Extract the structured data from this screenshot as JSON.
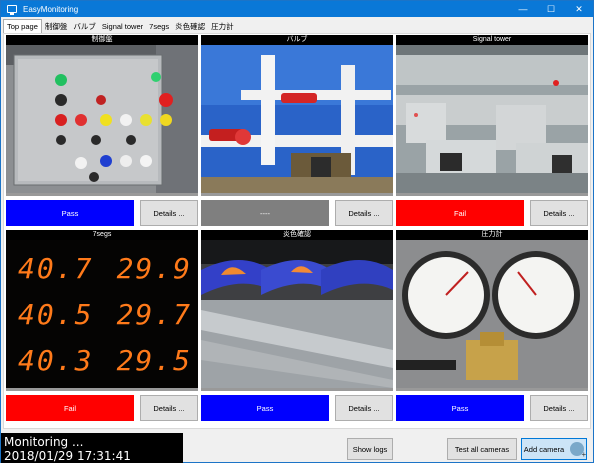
{
  "window": {
    "title": "EasyMonitoring"
  },
  "title_controls": {
    "minimize": "—",
    "maximize": "☐",
    "close": "✕"
  },
  "tabs": [
    "Top page",
    "制御盤",
    "バルブ",
    "Signal tower",
    "7segs",
    "炎色確認",
    "圧力計"
  ],
  "cameras": [
    {
      "title": "制御盤",
      "status": "Pass",
      "status_type": "pass",
      "details": "Details ..."
    },
    {
      "title": "バルブ",
      "status": "----",
      "status_type": "none",
      "details": "Details ..."
    },
    {
      "title": "Signal tower",
      "status": "Fail",
      "status_type": "fail",
      "details": "Details ..."
    },
    {
      "title": "7segs",
      "status": "Fail",
      "status_type": "fail",
      "details": "Details ..."
    },
    {
      "title": "炎色確認",
      "status": "Pass",
      "status_type": "pass",
      "details": "Details ..."
    },
    {
      "title": "圧力計",
      "status": "Pass",
      "status_type": "pass",
      "details": "Details ..."
    }
  ],
  "seg_display": [
    [
      "40.7",
      "29.9"
    ],
    [
      "40.5",
      "29.7"
    ],
    [
      "40.3",
      "29.5"
    ]
  ],
  "footer": {
    "status_line": "Monitoring ...",
    "datetime": "2018/01/29 17:31:41",
    "show_logs": "Show logs",
    "test_all": "Test all cameras",
    "add_camera": "Add camera"
  },
  "colors": {
    "pass": "#0000ff",
    "fail": "#ff0000",
    "none": "#7f7f7f",
    "titlebar": "#0a78d7"
  }
}
